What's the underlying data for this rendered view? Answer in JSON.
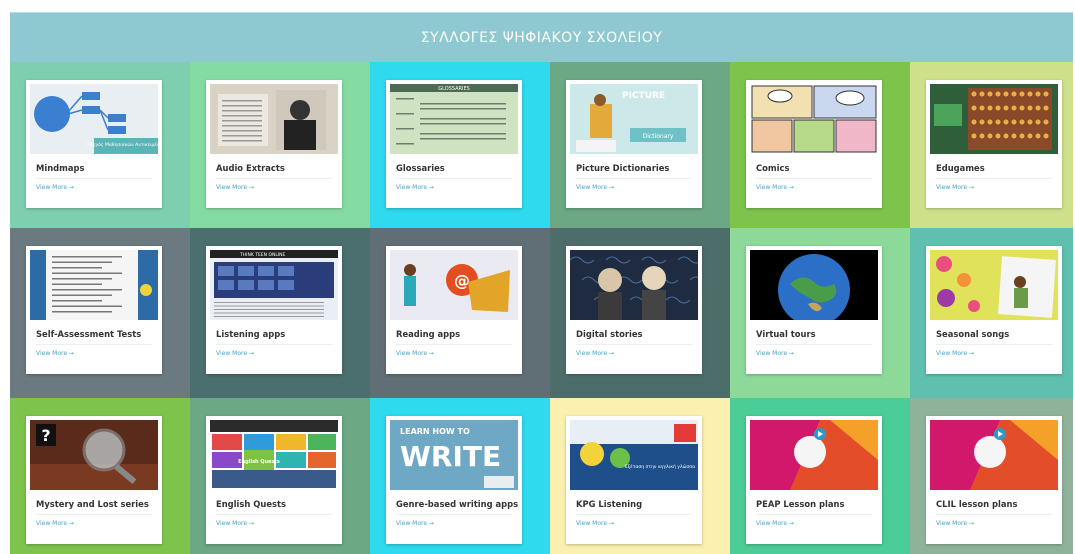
{
  "header": {
    "title": "ΣΥΛΛΟΓΕΣ ΨΗΦΙΑΚΟΥ ΣΧΟΛΕΙΟΥ"
  },
  "thumb_text": {
    "mindmaps_caption": "Οδηγός Μαθησιακών Αντικειμένων",
    "glossaries_heading": "GLOSSARIES",
    "picture_dict_heading": "PICTURE",
    "picture_dict_label": "Dictionary",
    "listening_heading": "THINK TEEN ONLINE",
    "quest_logo": "English Quests",
    "write_line1": "LEARN HOW TO",
    "write_line2": "WRITE",
    "kpg_text": "Εξέταση στην αγγλική γλώσσα"
  },
  "colors": {
    "header": "#8ec8d0",
    "link": "#4aa3c0"
  },
  "tiles": [
    {
      "title": "Mindmaps",
      "more": "View More →",
      "bg": "#7ecfb0",
      "icon": "mindmap-icon"
    },
    {
      "title": "Audio Extracts",
      "more": "View More →",
      "bg": "#84dba2",
      "icon": "audio-icon"
    },
    {
      "title": "Glossaries",
      "more": "View More →",
      "bg": "#2fd9ee",
      "icon": "glossary-icon"
    },
    {
      "title": "Picture Dictionaries",
      "more": "View More →",
      "bg": "#6ba883",
      "icon": "picture-dictionary-icon"
    },
    {
      "title": "Comics",
      "more": "View More →",
      "bg": "#7ec44c",
      "icon": "comics-icon"
    },
    {
      "title": "Edugames",
      "more": "View More →",
      "bg": "#cfe08a",
      "icon": "edugames-icon"
    },
    {
      "title": "Self-Assessment Tests",
      "more": "View More →",
      "bg": "#6b7a80",
      "icon": "test-icon"
    },
    {
      "title": "Listening apps",
      "more": "View More →",
      "bg": "#4a6f6e",
      "icon": "listening-icon"
    },
    {
      "title": "Reading apps",
      "more": "View More →",
      "bg": "#5f6f75",
      "icon": "reading-icon"
    },
    {
      "title": "Digital stories",
      "more": "View More →",
      "bg": "#4d6d6a",
      "icon": "story-icon"
    },
    {
      "title": "Virtual tours",
      "more": "View More →",
      "bg": "#8cd99a",
      "icon": "globe-icon"
    },
    {
      "title": "Seasonal songs",
      "more": "View More →",
      "bg": "#5fc0b0",
      "icon": "song-icon"
    },
    {
      "title": "Mystery and Lost series",
      "more": "View More →",
      "bg": "#7ec44c",
      "icon": "mystery-icon"
    },
    {
      "title": "English Quests",
      "more": "View More →",
      "bg": "#6ba883",
      "icon": "quest-icon"
    },
    {
      "title": "Genre-based writing apps",
      "more": "View More →",
      "bg": "#2fd9ee",
      "icon": "writing-icon"
    },
    {
      "title": "KPG Listening",
      "more": "View More →",
      "bg": "#fbf0b0",
      "icon": "kpg-icon"
    },
    {
      "title": "PEAP Lesson plans",
      "more": "View More →",
      "bg": "#4ccc96",
      "icon": "lesson-plan-icon"
    },
    {
      "title": "CLIL lesson plans",
      "more": "View More →",
      "bg": "#8fb39a",
      "icon": "clil-icon"
    }
  ]
}
